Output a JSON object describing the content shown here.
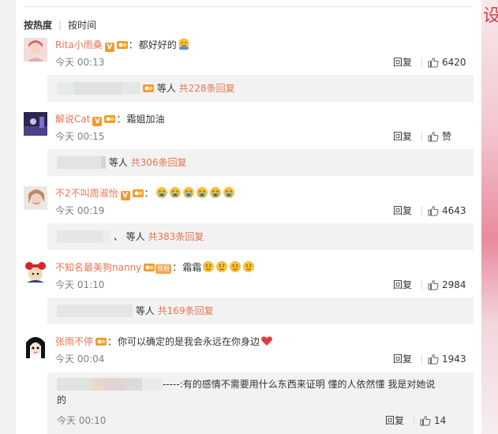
{
  "sort": {
    "hot_label": "按热度",
    "time_label": "按时间"
  },
  "background": {
    "deco_char": "设"
  },
  "comments": [
    {
      "user": "Rita小雨桑",
      "text": "都好好的",
      "time": "今天 00:13",
      "reply_label": "回复",
      "likes": "6420",
      "sub": {
        "suffix": "等人",
        "link": "共228条回复"
      }
    },
    {
      "user": "解说Cat",
      "text": "霜姐加油",
      "time": "今天 00:15",
      "reply_label": "回复",
      "likes": "赞",
      "sub": {
        "suffix": "等人",
        "link": "共306条回复"
      }
    },
    {
      "user": "不2不叫周淑怡",
      "text": "",
      "time": "今天 00:19",
      "reply_label": "回复",
      "likes": "4643",
      "sub": {
        "prefix": "、",
        "suffix": "等人",
        "link": "共383条回复"
      }
    },
    {
      "user": "不知名最美狗nanny",
      "badge_tie": "铁粉",
      "text": "霜霜",
      "time": "今天 01:10",
      "reply_label": "回复",
      "likes": "2984",
      "sub": {
        "suffix": "等人",
        "link": "共169条回复"
      }
    },
    {
      "user": "张雨不停",
      "text": "你可以确定的是我会永远在你身边",
      "time": "今天 00:04",
      "reply_label": "回复",
      "likes": "1943",
      "sub_reply": {
        "text_line1": "-----:有的感情不需要用什么东西来证明 懂的人依然懂 我是对她说",
        "text_line2": "的",
        "time": "今天 00:10",
        "reply_label": "回复",
        "likes": "14"
      }
    }
  ],
  "icons": {
    "like": "thumbs-up-icon",
    "verified": "v-badge-icon",
    "fan": "fan-badge-icon"
  },
  "colors": {
    "link": "#eb7350",
    "muted": "#808080",
    "badge": "#f49a2d"
  }
}
